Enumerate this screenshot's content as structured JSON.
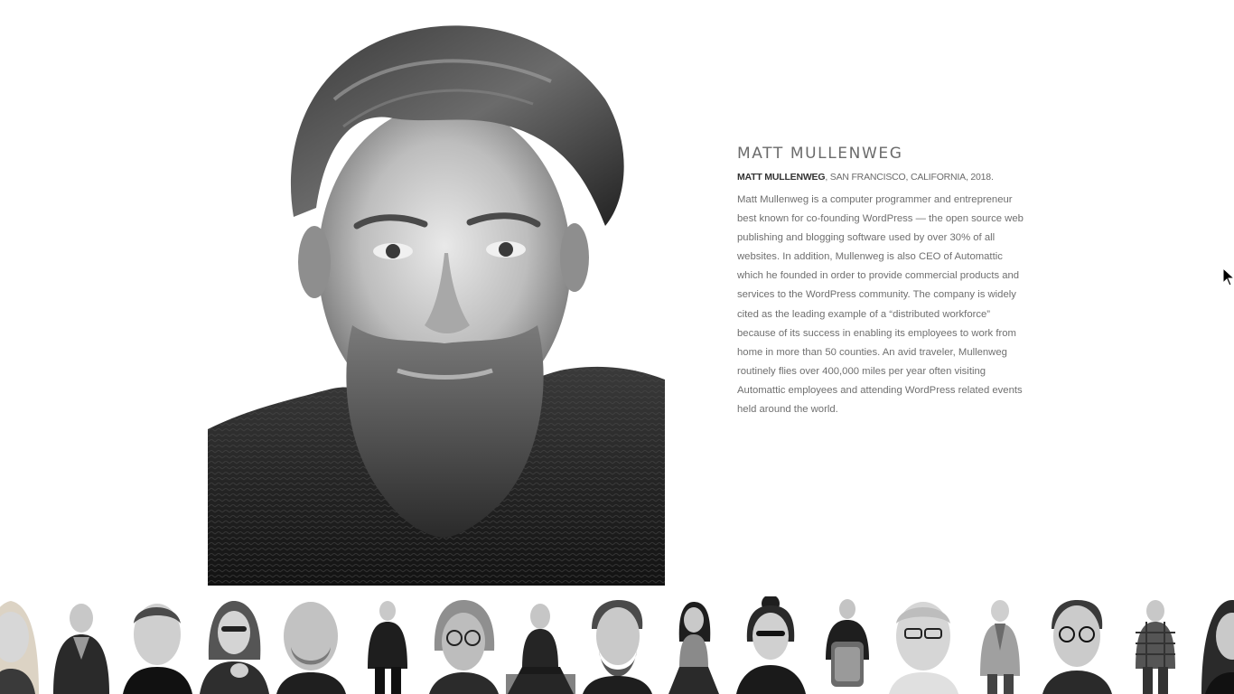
{
  "profile": {
    "name": "MATT MULLENWEG",
    "caption_name": "MATT MULLENWEG",
    "caption_rest": ", SAN FRANCISCO, CALIFORNIA, 2018.",
    "bio": "Matt Mullenweg is a computer programmer and entrepreneur best known for co-founding WordPress — the open source web publishing and blogging software used by over 30% of all websites. In addition, Mullenweg is also CEO of Automattic which he founded in order to provide commercial products and services to the WordPress community. The company is widely cited as the leading example of a “distributed workforce” because of its success in enabling its employees to work from home in more than 50 counties. An avid traveler, Mullenweg routinely flies over 400,000 miles per year often visiting Automattic employees and attending WordPress related events held around the world."
  },
  "thumbnails": [
    {
      "style": "long-hair-woman-closeup"
    },
    {
      "style": "man-in-hoodie"
    },
    {
      "style": "man-closeup"
    },
    {
      "style": "woman-with-glasses"
    },
    {
      "style": "bald-man-closeup"
    },
    {
      "style": "man-full-body-dark"
    },
    {
      "style": "older-man-glasses"
    },
    {
      "style": "man-seated-full-body"
    },
    {
      "style": "bearded-man-closeup"
    },
    {
      "style": "woman-seated"
    },
    {
      "style": "woman-with-glasses-bun"
    },
    {
      "style": "man-holding-object"
    },
    {
      "style": "elderly-man-glasses"
    },
    {
      "style": "elderly-man-suit"
    },
    {
      "style": "man-glasses-closeup"
    },
    {
      "style": "man-plaid-shirt"
    },
    {
      "style": "woman-long-hair-cropped"
    }
  ],
  "colors": {
    "name": "#6b6b6b",
    "caption_strong": "#333333",
    "body_text": "#6f6f6f",
    "background": "#ffffff"
  }
}
